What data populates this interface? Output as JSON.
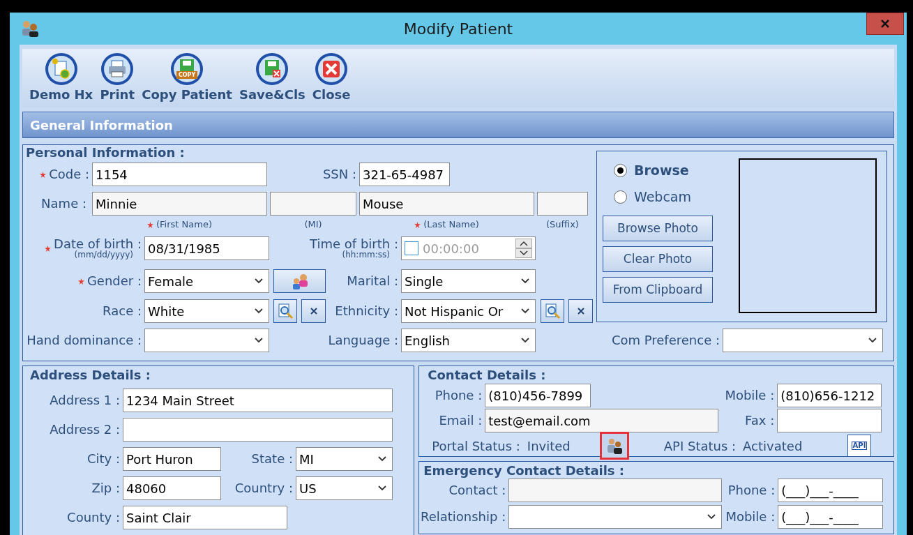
{
  "window": {
    "title": "Modify Patient"
  },
  "toolbar": [
    {
      "label": "Demo Hx",
      "kind": "history"
    },
    {
      "label": "Print",
      "kind": "print"
    },
    {
      "label": "Copy Patient",
      "kind": "copy",
      "badge": "COPY"
    },
    {
      "label": "Save&Cls",
      "kind": "save"
    },
    {
      "label": "Close",
      "kind": "close"
    }
  ],
  "section_title": "General Information",
  "personal": {
    "title": "Personal Information :",
    "code": {
      "label": "Code :",
      "value": "1154",
      "required": true
    },
    "ssn": {
      "label": "SSN :",
      "value": "321-65-4987"
    },
    "name": {
      "label": "Name :",
      "first": "Minnie",
      "last": "Mouse"
    },
    "name_hints": [
      {
        "text": "(First Name)",
        "required": true
      },
      {
        "text": "(MI)"
      },
      {
        "text": "(Last Name)",
        "required": true
      },
      {
        "text": "(Suffix)"
      }
    ],
    "dob": {
      "label": "Date of birth :",
      "hint": "(mm/dd/yyyy)",
      "value": "08/31/1985",
      "required": true
    },
    "tob": {
      "label": "Time of birth :",
      "hint": "(hh:mm:ss)",
      "value": "00:00:00",
      "checked": false,
      "disabled": true
    },
    "gender": {
      "label": "Gender :",
      "value": "Female",
      "required": true
    },
    "marital": {
      "label": "Marital :",
      "value": "Single"
    },
    "race": {
      "label": "Race :",
      "value": "White"
    },
    "ethnicity": {
      "label": "Ethnicity :",
      "value": "Not Hispanic Or"
    },
    "hand": {
      "label": "Hand dominance :"
    },
    "language": {
      "label": "Language :",
      "value": "English"
    },
    "com_pref": {
      "label": "Com Preference :"
    }
  },
  "photo": {
    "sources": [
      {
        "label": "Browse",
        "selected": true
      },
      {
        "label": "Webcam",
        "selected": false
      }
    ],
    "buttons": [
      "Browse Photo",
      "Clear Photo",
      "From Clipboard"
    ]
  },
  "address": {
    "title": "Address Details :",
    "address1": {
      "label": "Address 1 :",
      "value": "1234 Main Street"
    },
    "address2": {
      "label": "Address 2 :"
    },
    "city": {
      "label": "City :",
      "value": "Port Huron"
    },
    "state": {
      "label": "State :",
      "value": "MI"
    },
    "zip": {
      "label": "Zip :",
      "value": "48060"
    },
    "country": {
      "label": "Country :",
      "value": "US"
    },
    "county": {
      "label": "County :",
      "value": "Saint Clair"
    }
  },
  "contact": {
    "title": "Contact Details :",
    "phone": {
      "label": "Phone :",
      "value": "(810)456-7899"
    },
    "mobile": {
      "label": "Mobile :",
      "value": "(810)656-1212"
    },
    "email": {
      "label": "Email :",
      "value": "test@email.com"
    },
    "fax": {
      "label": "Fax :"
    },
    "portal": {
      "label": "Portal Status :",
      "value": "Invited"
    },
    "api": {
      "label": "API Status :",
      "value": "Activated",
      "button": "API"
    }
  },
  "emergency": {
    "title": "Emergency Contact Details  :",
    "contact": {
      "label": "Contact :"
    },
    "phone": {
      "label": "Phone :",
      "value": "(___)___-____"
    },
    "relationship": {
      "label": "Relationship :"
    },
    "mobile": {
      "label": "Mobile :",
      "value": "(___)___-____"
    }
  }
}
